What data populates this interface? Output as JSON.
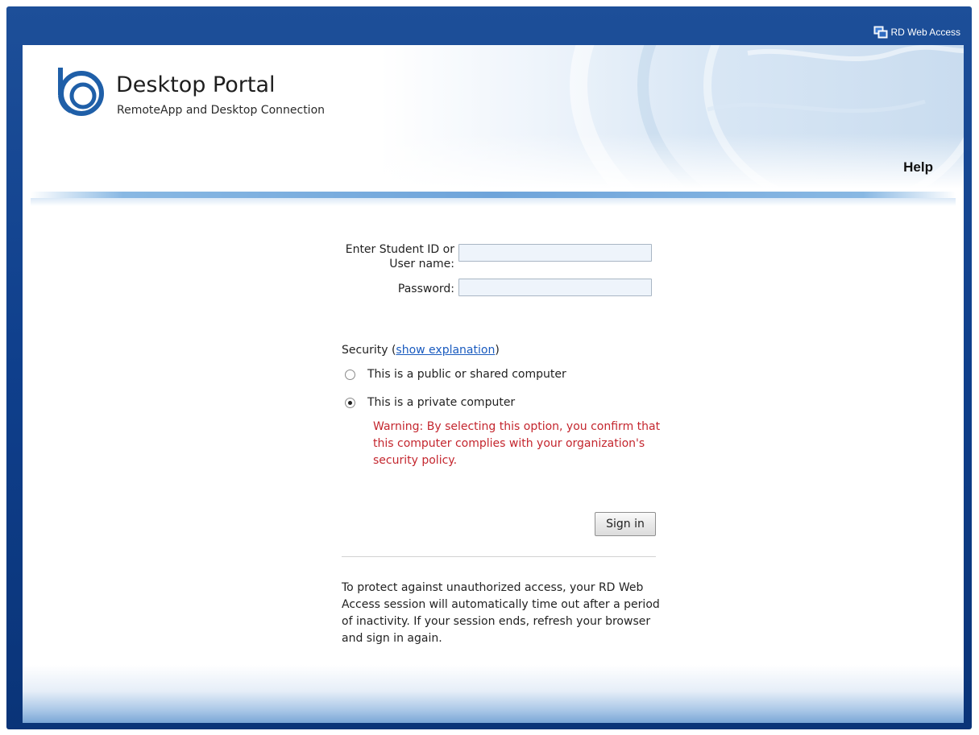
{
  "topbar": {
    "label": "RD Web Access",
    "icon": "rd-web-access-icon"
  },
  "header": {
    "title": "Desktop Portal",
    "subtitle": "RemoteApp and Desktop Connection",
    "help_link": "Help",
    "logo_icon": "portal-logo-icon"
  },
  "form": {
    "username_label_line1": "Enter Student ID or",
    "username_label_line2": "User name:",
    "username_value": "",
    "password_label": "Password:",
    "password_value": ""
  },
  "security": {
    "label": "Security (",
    "link": "show explanation",
    "label_end": ")",
    "options": [
      {
        "label": "This is a public or shared computer",
        "selected": false
      },
      {
        "label": "This is a private computer",
        "selected": true
      }
    ],
    "warning": "Warning: By selecting this option, you confirm that this computer complies with your organization's security policy."
  },
  "signin_button": "Sign in",
  "info_text": "To protect against unauthorized access, your RD Web Access session will automatically time out after a period of inactivity. If your session ends, refresh your browser and sign in again.",
  "colors": {
    "frame": "#0f3f8c",
    "warning": "#c4262e",
    "link": "#1a5bbf",
    "field_bg": "#eef4fb"
  }
}
